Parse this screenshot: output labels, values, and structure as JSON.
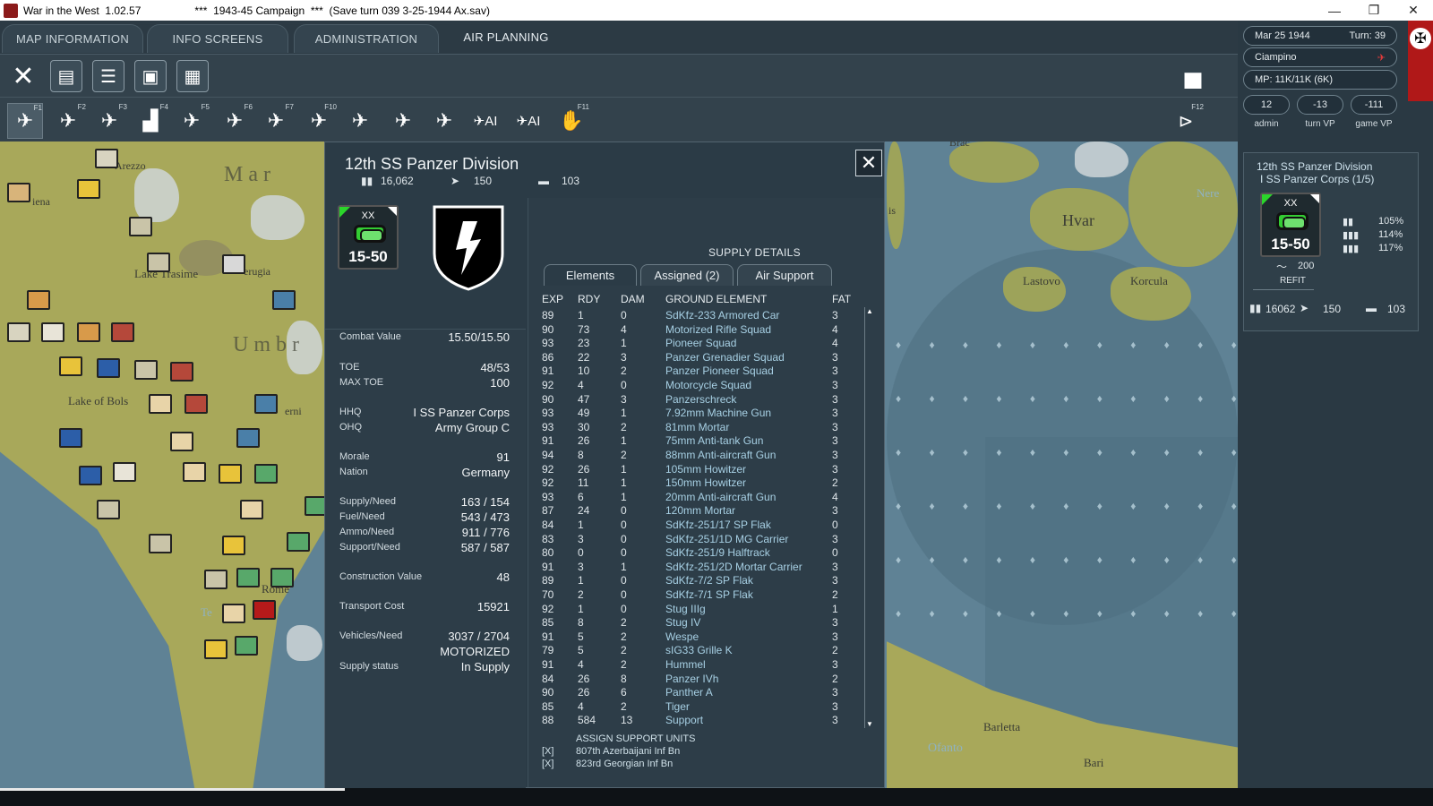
{
  "window": {
    "app_title": "War in the West  1.02.57",
    "campaign": "***  1943-45 Campaign  ***  (Save turn 039 3-25-1944 Ax.sav)",
    "controls": [
      "—",
      "❐",
      "✕"
    ]
  },
  "menu": {
    "tabs": [
      "MAP INFORMATION",
      "INFO SCREENS",
      "ADMINISTRATION",
      "AIR PLANNING"
    ]
  },
  "toolbar": {
    "buttons": [
      "close",
      "unit-list",
      "list",
      "save",
      "game-options"
    ]
  },
  "air_toolbar": {
    "fkeys": [
      "F1",
      "F2",
      "F3",
      "F4",
      "F5",
      "F6",
      "F7",
      "F10",
      "F11",
      "F12"
    ],
    "ai_labels": [
      "AI",
      "AI"
    ]
  },
  "status": {
    "date": "Mar 25 1944",
    "turn": "Turn: 39",
    "location": "Ciampino",
    "mp": "MP: 11K/11K (6K)",
    "admin": "12",
    "turn_vp": "-13",
    "game_vp": "-111",
    "admin_label": "admin",
    "turn_vp_label": "turn VP",
    "game_vp_label": "game VP"
  },
  "unit_card": {
    "name": "12th SS Panzer Division",
    "corps": "I SS Panzer Corps (1/5)",
    "counter_size": "XX",
    "counter_value": "15-50",
    "pct1": "105%",
    "pct2": "114%",
    "pct3": "117%",
    "air": "200",
    "refit": "REFIT",
    "men": "16062",
    "guns": "150",
    "tanks": "103"
  },
  "map_labels": {
    "arezzo": "Arezzo",
    "siena": "iena",
    "trasimeno": "Lake Trasime",
    "perugia": "erugia",
    "marche": "M a r",
    "umbria": "U m b r",
    "bolsena": "Lake of Bols",
    "terni": "erni",
    "rome": "Rome",
    "brac": "Brac",
    "hvar": "Hvar",
    "lastovo": "Lastovo",
    "korcula": "Korcula",
    "nere": "Nere",
    "is": "is",
    "barletta": "Barletta",
    "ofanto": "Ofanto",
    "bari": "Bari",
    "te": "Te"
  },
  "dialog": {
    "title": "12th SS Panzer Division",
    "men": "16,062",
    "guns": "150",
    "tanks": "103",
    "counter_size": "XX",
    "counter_value": "15-50",
    "stats": [
      {
        "label": "Combat Value",
        "value": "15.50/15.50"
      },
      {
        "label": "TOE",
        "value": "48/53"
      },
      {
        "label": "MAX TOE",
        "value": "100"
      },
      {
        "label": "HHQ",
        "value": "I SS Panzer Corps"
      },
      {
        "label": "OHQ",
        "value": "Army Group C"
      },
      {
        "label": "Morale",
        "value": "91"
      },
      {
        "label": "Nation",
        "value": "Germany"
      },
      {
        "label": "Supply/Need",
        "value": "163 / 154"
      },
      {
        "label": "Fuel/Need",
        "value": "543 / 473"
      },
      {
        "label": "Ammo/Need",
        "value": "911 / 776"
      },
      {
        "label": "Support/Need",
        "value": "587 / 587"
      },
      {
        "label": "Construction Value",
        "value": "48"
      },
      {
        "label": "Transport Cost",
        "value": "15921"
      },
      {
        "label": "Vehicles/Need",
        "value": "3037 / 2704"
      },
      {
        "label": "",
        "value": "MOTORIZED"
      },
      {
        "label": "Supply status",
        "value": "In Supply"
      }
    ],
    "supply_details": "SUPPLY DETAILS",
    "tabs": [
      "Elements",
      "Assigned (2)",
      "Air Support"
    ],
    "columns": [
      "EXP",
      "RDY",
      "DAM",
      "GROUND ELEMENT",
      "FAT"
    ],
    "elements": [
      [
        "89",
        "1",
        "0",
        "SdKfz-233 Armored Car",
        "3"
      ],
      [
        "90",
        "73",
        "4",
        "Motorized Rifle Squad",
        "4"
      ],
      [
        "93",
        "23",
        "1",
        "Pioneer Squad",
        "4"
      ],
      [
        "86",
        "22",
        "3",
        "Panzer Grenadier Squad",
        "3"
      ],
      [
        "91",
        "10",
        "2",
        "Panzer Pioneer Squad",
        "3"
      ],
      [
        "92",
        "4",
        "0",
        "Motorcycle Squad",
        "3"
      ],
      [
        "90",
        "47",
        "3",
        "Panzerschreck",
        "3"
      ],
      [
        "93",
        "49",
        "1",
        "7.92mm Machine Gun",
        "3"
      ],
      [
        "93",
        "30",
        "2",
        "81mm Mortar",
        "3"
      ],
      [
        "91",
        "26",
        "1",
        "75mm Anti-tank Gun",
        "3"
      ],
      [
        "94",
        "8",
        "2",
        "88mm Anti-aircraft Gun",
        "3"
      ],
      [
        "92",
        "26",
        "1",
        "105mm Howitzer",
        "3"
      ],
      [
        "92",
        "11",
        "1",
        "150mm Howitzer",
        "2"
      ],
      [
        "93",
        "6",
        "1",
        "20mm Anti-aircraft Gun",
        "4"
      ],
      [
        "87",
        "24",
        "0",
        "120mm Mortar",
        "3"
      ],
      [
        "84",
        "1",
        "0",
        "SdKfz-251/17 SP Flak",
        "0"
      ],
      [
        "83",
        "3",
        "0",
        "SdKfz-251/1D MG Carrier",
        "3"
      ],
      [
        "80",
        "0",
        "0",
        "SdKfz-251/9 Halftrack",
        "0"
      ],
      [
        "91",
        "3",
        "1",
        "SdKfz-251/2D Mortar Carrier",
        "3"
      ],
      [
        "89",
        "1",
        "0",
        "SdKfz-7/2 SP Flak",
        "3"
      ],
      [
        "70",
        "2",
        "0",
        "SdKfz-7/1 SP Flak",
        "2"
      ],
      [
        "92",
        "1",
        "0",
        "Stug IIIg",
        "1"
      ],
      [
        "85",
        "8",
        "2",
        "Stug IV",
        "3"
      ],
      [
        "91",
        "5",
        "2",
        "Wespe",
        "3"
      ],
      [
        "79",
        "5",
        "2",
        "sIG33 Grille K",
        "2"
      ],
      [
        "91",
        "4",
        "2",
        "Hummel",
        "3"
      ],
      [
        "84",
        "26",
        "8",
        "Panzer IVh",
        "2"
      ],
      [
        "90",
        "26",
        "6",
        "Panther A",
        "3"
      ],
      [
        "85",
        "4",
        "2",
        "Tiger",
        "3"
      ],
      [
        "88",
        "584",
        "13",
        "Support",
        "3"
      ]
    ],
    "assign_title": "ASSIGN SUPPORT UNITS",
    "assigned": [
      {
        "mark": "[X]",
        "name": "807th Azerbaijani Inf Bn"
      },
      {
        "mark": "[X]",
        "name": "823rd Georgian Inf Bn"
      }
    ]
  }
}
